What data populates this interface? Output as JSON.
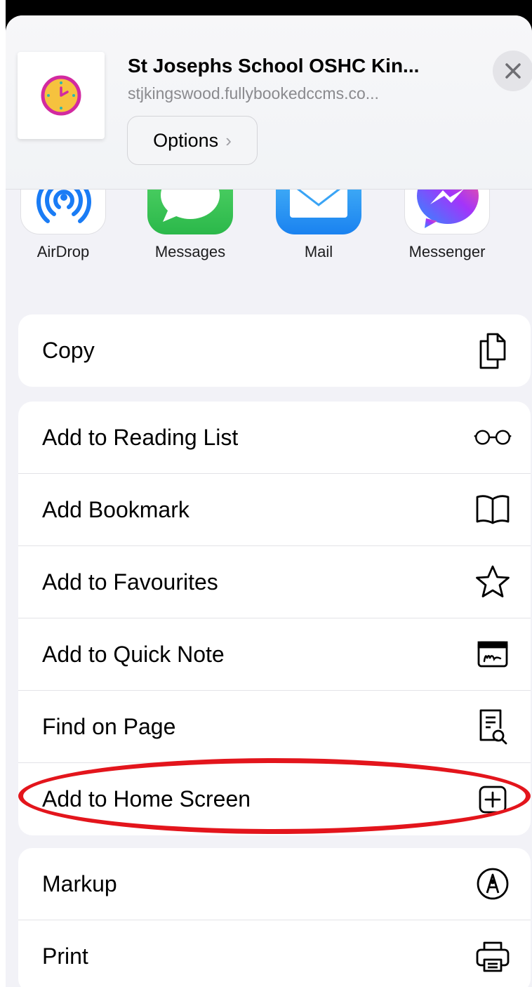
{
  "header": {
    "site_title": "St Josephs School OSHC Kin...",
    "site_url": "stjkingswood.fullybookedccms.co...",
    "options_label": "Options",
    "thumbnail_icon": "clock-icon",
    "close_icon": "close-icon"
  },
  "apps": [
    {
      "label": "AirDrop",
      "icon": "airdrop-icon"
    },
    {
      "label": "Messages",
      "icon": "messages-icon"
    },
    {
      "label": "Mail",
      "icon": "mail-icon"
    },
    {
      "label": "Messenger",
      "icon": "messenger-icon"
    }
  ],
  "actions": {
    "group1": [
      {
        "label": "Copy",
        "icon": "copy-icon"
      }
    ],
    "group2": [
      {
        "label": "Add to Reading List",
        "icon": "glasses-icon"
      },
      {
        "label": "Add Bookmark",
        "icon": "book-icon"
      },
      {
        "label": "Add to Favourites",
        "icon": "star-icon"
      },
      {
        "label": "Add to Quick Note",
        "icon": "quick-note-icon"
      },
      {
        "label": "Find on Page",
        "icon": "find-on-page-icon"
      },
      {
        "label": "Add to Home Screen",
        "icon": "plus-square-icon"
      }
    ],
    "group3": [
      {
        "label": "Markup",
        "icon": "markup-icon"
      },
      {
        "label": "Print",
        "icon": "printer-icon"
      }
    ]
  },
  "colors": {
    "highlight": "#e3151c",
    "airdrop": "#1a7cf5",
    "messages": "#34c759",
    "mail": "#1e9cf7",
    "messenger_gradient": [
      "#2d8cff",
      "#a334fa",
      "#ff5c87"
    ]
  }
}
